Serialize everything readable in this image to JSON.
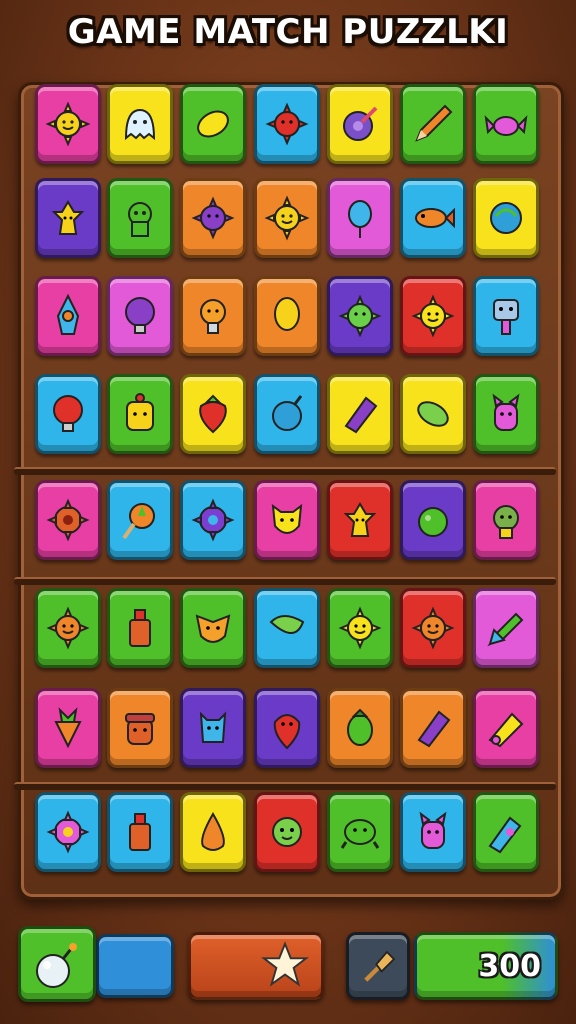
{
  "title": "GAME MATCH PUZZLKI",
  "score": "300",
  "colors": {
    "pink": "#e83fa5",
    "yellow": "#f7e21b",
    "green": "#4fbf2a",
    "blue": "#2fb5ea",
    "purple": "#6a3bc7",
    "orange": "#f0862a",
    "red": "#e0302a",
    "magenta": "#e35ad8"
  },
  "rows": [
    [
      [
        "pink",
        "sun-face-icon"
      ],
      [
        "yellow",
        "ghost-icon"
      ],
      [
        "green",
        "lemon-icon"
      ],
      [
        "blue",
        "red-spiky-ball-icon"
      ],
      [
        "yellow",
        "purple-orb-icon"
      ],
      [
        "green",
        "pencil-icon"
      ],
      [
        "green",
        "pink-candy-icon"
      ]
    ],
    [
      [
        "purple",
        "yellow-figure-icon"
      ],
      [
        "green",
        "green-creature-icon"
      ],
      [
        "orange",
        "purple-spiky-icon"
      ],
      [
        "orange",
        "sun-face-icon"
      ],
      [
        "magenta",
        "blue-balloon-icon"
      ],
      [
        "blue",
        "fish-icon"
      ],
      [
        "yellow",
        "blue-ball-icon"
      ]
    ],
    [
      [
        "pink",
        "rocket-icon"
      ],
      [
        "magenta",
        "purple-bulb-icon"
      ],
      [
        "orange",
        "orange-trophy-icon"
      ],
      [
        "orange",
        "yellow-balloon-icon"
      ],
      [
        "purple",
        "green-sun-icon"
      ],
      [
        "red",
        "yellow-sun-icon"
      ],
      [
        "blue",
        "robot-icon"
      ]
    ],
    [
      [
        "blue",
        "red-bulb-icon"
      ],
      [
        "green",
        "yellow-face-icon"
      ],
      [
        "yellow",
        "strawberry-icon"
      ],
      [
        "blue",
        "bomb-icon"
      ],
      [
        "yellow",
        "purple-crystal-icon"
      ],
      [
        "yellow",
        "green-lemon-icon"
      ],
      [
        "green",
        "pink-creature-icon"
      ]
    ],
    [
      [
        "pink",
        "red-gear-icon"
      ],
      [
        "blue",
        "orange-lollipop-icon"
      ],
      [
        "blue",
        "purple-gear-icon"
      ],
      [
        "pink",
        "yellow-cat-icon"
      ],
      [
        "red",
        "yellow-figure-icon"
      ],
      [
        "purple",
        "green-ball-icon"
      ],
      [
        "pink",
        "green-monster-icon"
      ]
    ],
    [
      [
        "green",
        "orange-sun-icon"
      ],
      [
        "green",
        "paint-bottle-icon"
      ],
      [
        "green",
        "orange-fox-icon"
      ],
      [
        "blue",
        "green-leaf-icon"
      ],
      [
        "green",
        "yellow-sun-icon"
      ],
      [
        "red",
        "orange-sun-icon"
      ],
      [
        "magenta",
        "green-rocket-icon"
      ]
    ],
    [
      [
        "pink",
        "carrot-icon"
      ],
      [
        "orange",
        "red-pot-icon"
      ],
      [
        "purple",
        "blue-creature-icon"
      ],
      [
        "purple",
        "red-balloon-icon"
      ],
      [
        "orange",
        "green-fruit-icon"
      ],
      [
        "orange",
        "purple-crystal-icon"
      ],
      [
        "pink",
        "yellow-cannon-icon"
      ]
    ],
    [
      [
        "blue",
        "pink-gear-icon"
      ],
      [
        "blue",
        "paint-bottle-icon"
      ],
      [
        "yellow",
        "orange-drop-icon"
      ],
      [
        "red",
        "green-face-icon"
      ],
      [
        "green",
        "green-turtle-icon"
      ],
      [
        "blue",
        "pink-creature-icon"
      ],
      [
        "green",
        "potion-icon"
      ]
    ]
  ]
}
